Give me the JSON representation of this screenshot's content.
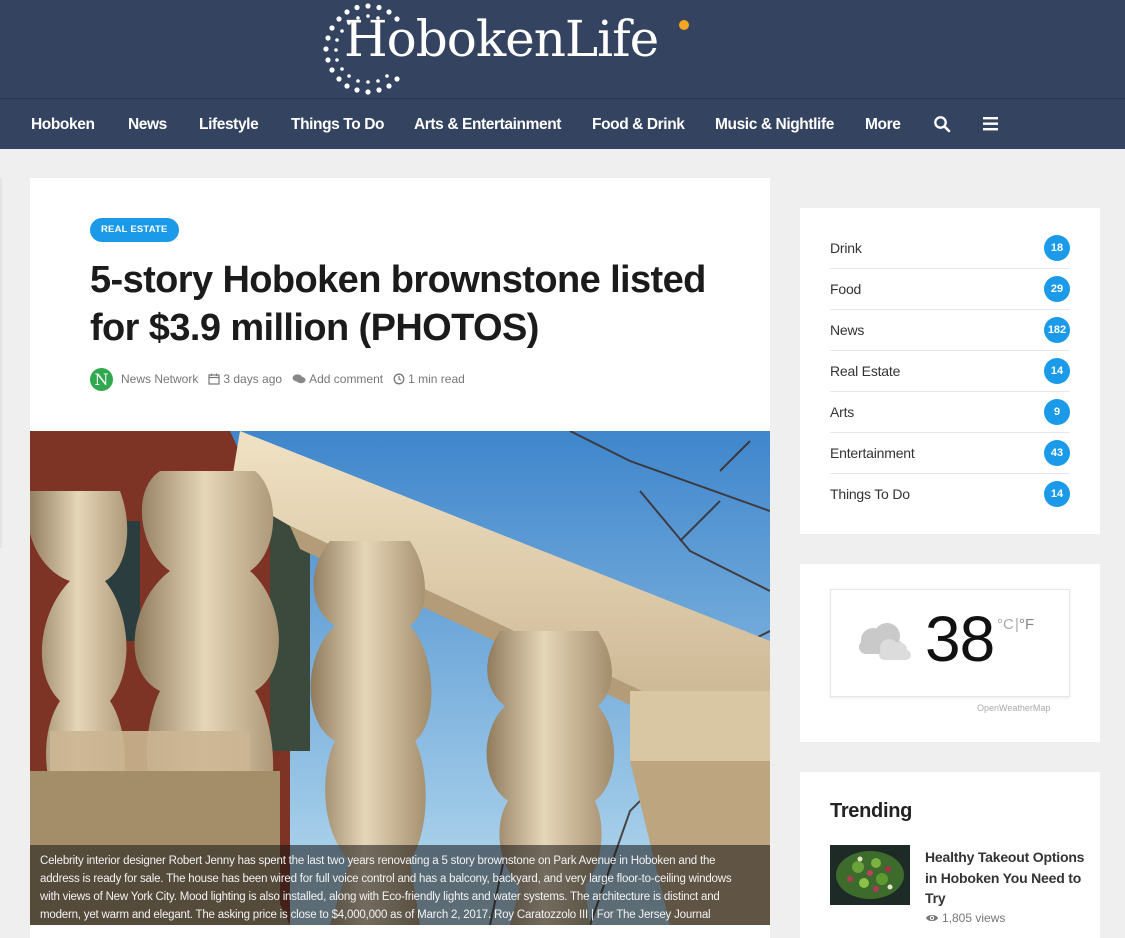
{
  "site": {
    "logo_text": "HobokenLife"
  },
  "nav": {
    "items": [
      "Hoboken",
      "News",
      "Lifestyle",
      "Things To Do",
      "Arts & Entertainment",
      "Food & Drink",
      "Music & Nightlife",
      "More"
    ]
  },
  "article": {
    "category": "REAL ESTATE",
    "title": "5-story Hoboken brownstone listed for $3.9 million (PHOTOS)",
    "author_initial": "N",
    "author": "News Network",
    "date": "3 days ago",
    "comment": "Add comment",
    "read_time": "1 min read",
    "caption": "Celebrity interior designer Robert Jenny has spent the last two years renovating a 5 story brownstone on Park Avenue in Hoboken and the address is ready for sale. The house has been wired for full voice control and has a balcony, backyard, and very large floor-to-ceiling windows with views of New York City. Mood lighting is also installed, along with Eco-friendly lights and water systems. The architecture is distinct and modern, yet warm and elegant. The asking price is close to $4,000,000 as of March 2, 2017. Roy Caratozzolo III | For The Jersey Journal"
  },
  "categories": [
    {
      "label": "Drink",
      "count": "18"
    },
    {
      "label": "Food",
      "count": "29"
    },
    {
      "label": "News",
      "count": "182"
    },
    {
      "label": "Real Estate",
      "count": "14"
    },
    {
      "label": "Arts",
      "count": "9"
    },
    {
      "label": "Entertainment",
      "count": "43"
    },
    {
      "label": "Things To Do",
      "count": "14"
    }
  ],
  "weather": {
    "temperature": "38",
    "unit_c": "°C",
    "separator": "|",
    "unit_f": "°F",
    "provider": "OpenWeatherMap",
    "icon": "cloud-icon"
  },
  "trending": {
    "heading": "Trending",
    "items": [
      {
        "title": "Healthy Takeout Options in Hoboken You Need to Try",
        "views": "1,805 views"
      }
    ]
  },
  "colors": {
    "header_bg": "#344360",
    "accent_blue": "#1a9ae8",
    "logo_dot": "#f5a623",
    "avatar_green": "#2fa84f"
  }
}
